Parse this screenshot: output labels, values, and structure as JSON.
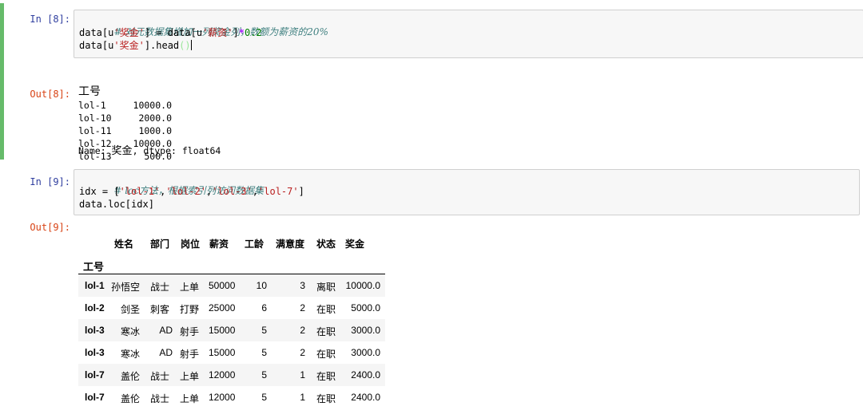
{
  "cell8": {
    "in_prompt": "In [8]:",
    "out_prompt": "Out[8]:",
    "code": [
      {
        "comment": "# 对元数据集增加一列奖金列，数额为薪资的20%"
      },
      {
        "p1": "data[u",
        "s1": "'奖金'",
        "p2": "] = data[u",
        "s2": "'薪资'",
        "p3": "]",
        "op": "*",
        "num": "0.2"
      },
      {
        "p1": "data[u",
        "s1": "'奖金'",
        "p2": "].head",
        "br": "()"
      }
    ],
    "output": {
      "header": "工号",
      "rows": [
        {
          "idx": "lol-1",
          "val": "10000.0"
        },
        {
          "idx": "lol-10",
          "val": "2000.0"
        },
        {
          "idx": "lol-11",
          "val": "1000.0"
        },
        {
          "idx": "lol-12",
          "val": "10000.0"
        },
        {
          "idx": "lol-13",
          "val": "500.0"
        }
      ],
      "footer_name_label": "Name: ",
      "footer_name": "奖金",
      "footer_rest": ", dtype: float64"
    }
  },
  "cell9": {
    "in_prompt": "In [9]:",
    "out_prompt": "Out[9]:",
    "code": [
      {
        "comment": "# loc方法，根据索引列访问数据集"
      },
      {
        "p1": "idx = [",
        "s1": "'lol-1'",
        "c1": ",",
        "s2": "'lol-2'",
        "c2": ",",
        "s3": "'lol-3'",
        "c3": ",",
        "s4": "'lol-7'",
        "p2": "]"
      },
      {
        "p1": "data.loc[idx]"
      }
    ],
    "table": {
      "columns": [
        "姓名",
        "部门",
        "岗位",
        "薪资",
        "工龄",
        "满意度",
        "状态",
        "奖金"
      ],
      "index_name": "工号",
      "rows": [
        {
          "idx": "lol-1",
          "cells": [
            "孙悟空",
            "战士",
            "上单",
            "50000",
            "10",
            "3",
            "离职",
            "10000.0"
          ]
        },
        {
          "idx": "lol-2",
          "cells": [
            "剑圣",
            "刺客",
            "打野",
            "25000",
            "6",
            "2",
            "在职",
            "5000.0"
          ]
        },
        {
          "idx": "lol-3",
          "cells": [
            "寒冰",
            "AD",
            "射手",
            "15000",
            "5",
            "2",
            "在职",
            "3000.0"
          ]
        },
        {
          "idx": "lol-3",
          "cells": [
            "寒冰",
            "AD",
            "射手",
            "15000",
            "5",
            "2",
            "在职",
            "3000.0"
          ]
        },
        {
          "idx": "lol-7",
          "cells": [
            "盖伦",
            "战士",
            "上单",
            "12000",
            "5",
            "1",
            "在职",
            "2400.0"
          ]
        },
        {
          "idx": "lol-7",
          "cells": [
            "盖伦",
            "战士",
            "上单",
            "12000",
            "5",
            "1",
            "在职",
            "2400.0"
          ]
        }
      ]
    }
  },
  "colors": {
    "selected_cell_bar": "#66bb6a",
    "in_prompt": "#303f9f",
    "out_prompt": "#d84315",
    "comment": "#408080",
    "string": "#ba2121",
    "number": "#008000",
    "operator": "#aa22ff"
  }
}
